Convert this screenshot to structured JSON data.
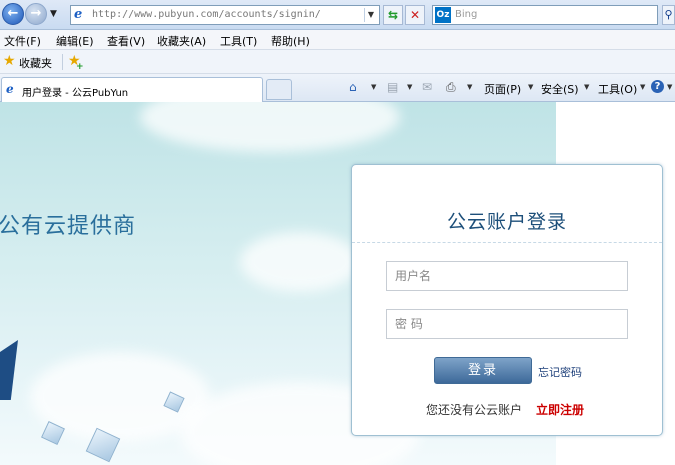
{
  "browser": {
    "url": "http://www.pubyun.com/accounts/signin/",
    "url_host": "http://www.pubyun.com",
    "url_path": "/accounts/signin/",
    "search_placeholder": "Bing",
    "search_logo": "Oz",
    "menu": [
      "文件(F)",
      "编辑(E)",
      "查看(V)",
      "收藏夹(A)",
      "工具(T)",
      "帮助(H)"
    ],
    "favorites_label": "收藏夹",
    "tab_title": "用户登录 - 公云PubYun",
    "commands": {
      "page": "页面(P)",
      "safety": "安全(S)",
      "tools": "工具(O)"
    },
    "icons": [
      "back-icon",
      "forward-icon",
      "ie-icon",
      "refresh-icon",
      "stop-icon",
      "bing-icon",
      "search-icon",
      "star-icon",
      "add-favorite-icon",
      "home-icon",
      "rss-icon",
      "mail-icon",
      "print-icon",
      "help-icon"
    ]
  },
  "page": {
    "tagline": "公有云提供商",
    "login": {
      "title": "公云账户登录",
      "username_placeholder": "用户名",
      "password_placeholder": "密 码",
      "submit_label": "登录",
      "forgot_label": "忘记密码",
      "no_account_text": "您还没有公云账户",
      "register_label": "立即注册"
    },
    "colors": {
      "title": "#1d4f7a",
      "button": "#3d6999",
      "register": "#cc0000",
      "tagline": "#2a6f9c"
    }
  }
}
